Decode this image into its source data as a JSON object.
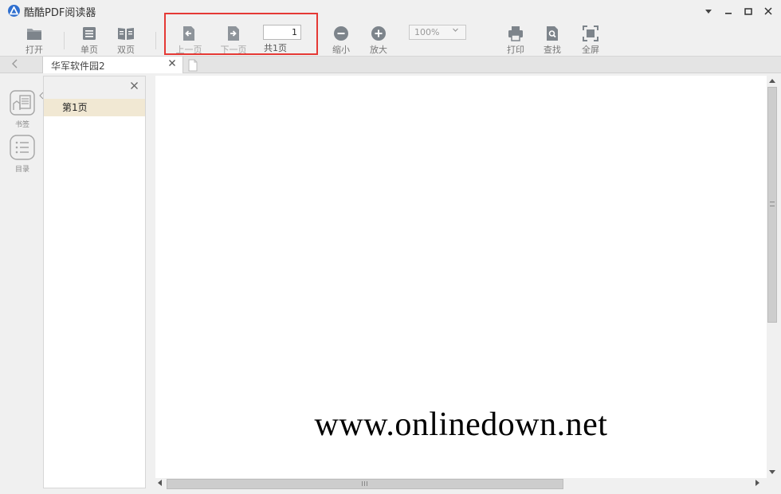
{
  "app": {
    "title": "酷酷PDF阅读器",
    "accent_color": "#2f6fcf"
  },
  "window_controls": {
    "menu_icon": "dropdown-menu-icon",
    "minimize_icon": "minimize-icon",
    "maximize_icon": "maximize-icon",
    "close_icon": "close-icon"
  },
  "toolbar": {
    "open_label": "打开",
    "single_page_label": "单页",
    "double_page_label": "双页",
    "prev_page_label": "上一页",
    "next_page_label": "下一页",
    "page_input_value": "1",
    "page_total_label": "共1页",
    "zoom_out_label": "缩小",
    "zoom_in_label": "放大",
    "zoom_value": "100%",
    "print_label": "打印",
    "find_label": "查找",
    "fullscreen_label": "全屏",
    "highlight_color": "#e53935"
  },
  "tabs": {
    "active_tab_title": "华军软件园2"
  },
  "rail": {
    "bookmark_label": "书签",
    "toc_label": "目录"
  },
  "sidepanel": {
    "items": [
      {
        "label": "第1页"
      }
    ],
    "selected_color": "#f1e8d3"
  },
  "document": {
    "watermark_text": "www.onlinedown.net"
  }
}
